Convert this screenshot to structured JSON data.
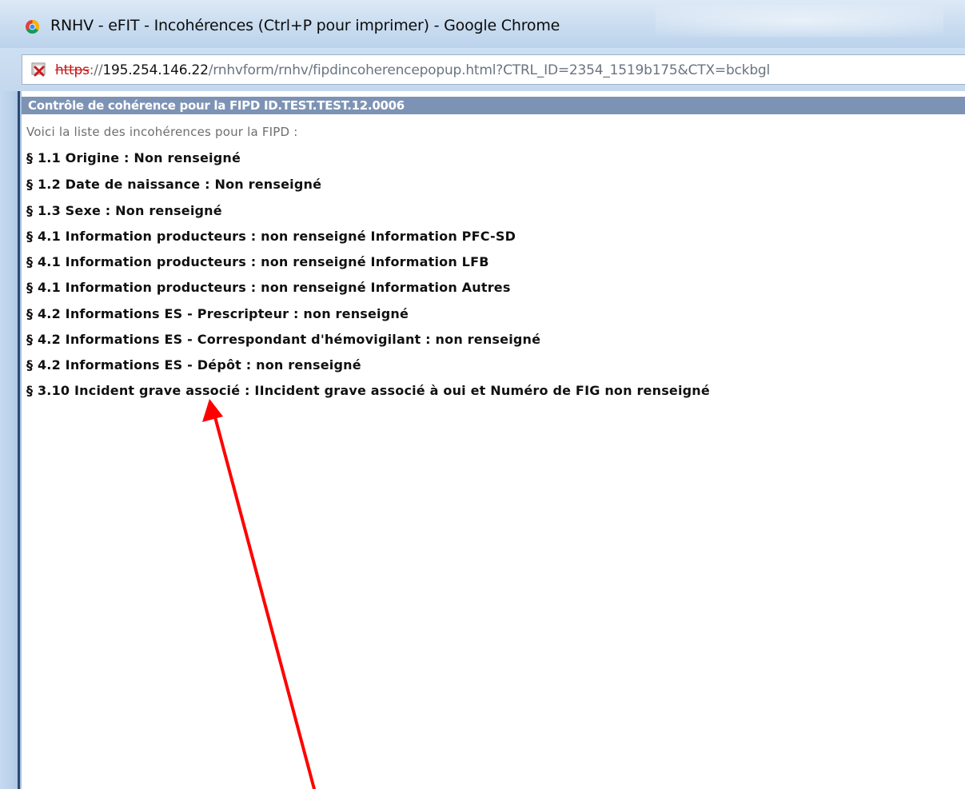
{
  "window": {
    "title": "RNHV - eFIT - Incohérences (Ctrl+P pour imprimer) - Google Chrome"
  },
  "address_bar": {
    "scheme": "https",
    "separator": "://",
    "host": "195.254.146.22",
    "path": "/rnhvform/rnhv/fipdincoherencepopup.html?CTRL_ID=2354_1519b175&CTX=bckbgl",
    "security_icon": "broken-lock-icon"
  },
  "panel": {
    "header": "Contrôle de cohérence pour la FIPD ID.TEST.TEST.12.0006",
    "subtitle": "Voici la liste des incohérences pour la FIPD :",
    "issues": [
      "§ 1.1 Origine : Non renseigné",
      "§ 1.2 Date de naissance : Non renseigné",
      "§ 1.3 Sexe : Non renseigné",
      "§ 4.1 Information producteurs : non renseigné Information PFC-SD",
      "§ 4.1 Information producteurs : non renseigné Information LFB",
      "§ 4.1 Information producteurs : non renseigné Information Autres",
      "§ 4.2 Informations ES - Prescripteur : non renseigné",
      "§ 4.2 Informations ES - Correspondant d'hémovigilant : non renseigné",
      "§ 4.2 Informations ES - Dépôt : non renseigné",
      "§ 3.10 Incident grave associé : IIncident grave associé à oui et Numéro de FIG non renseigné"
    ]
  },
  "colors": {
    "header_bar": "#7d93b5",
    "annotation_arrow": "#ff0000",
    "broken_https": "#c81414"
  },
  "icons": {
    "browser": "chrome-icon",
    "annotation": "red-arrow-icon"
  }
}
